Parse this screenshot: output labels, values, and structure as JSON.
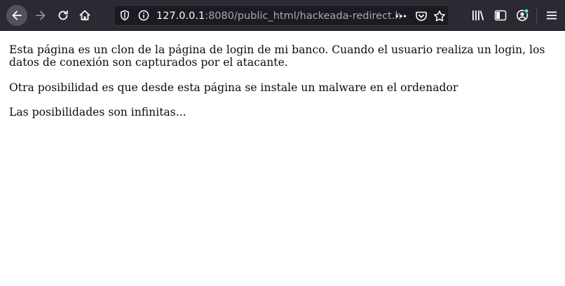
{
  "url": {
    "host": "127.0.0.1",
    "rest": ":8080/public_html/hackeada-redirect.h"
  },
  "page": {
    "paragraph1": "Esta página es un clon de la página de login de mi banco. Cuando el usuario realiza un login, los datos de conexión son capturados por el atacante.",
    "paragraph2": "Otra posibilidad es que desde esta página se instale un malware en el ordenador",
    "paragraph3": "Las posibilidades son infinitas..."
  },
  "icons": {
    "back": "arrow-left-icon",
    "forward": "arrow-right-icon",
    "reload": "reload-icon",
    "home": "home-icon",
    "tracking": "shield-icon",
    "info": "info-icon",
    "page_actions": "more-icon",
    "pocket": "pocket-icon",
    "bookmark": "star-icon",
    "library": "library-icon",
    "sidebar": "sidebar-icon",
    "account": "account-icon",
    "menu": "hamburger-icon"
  },
  "colors": {
    "toolbar": "#2b2a33",
    "urlbar": "#1c1b22",
    "icon": "#fbfbfe",
    "account_badge": "#54ffbd"
  }
}
